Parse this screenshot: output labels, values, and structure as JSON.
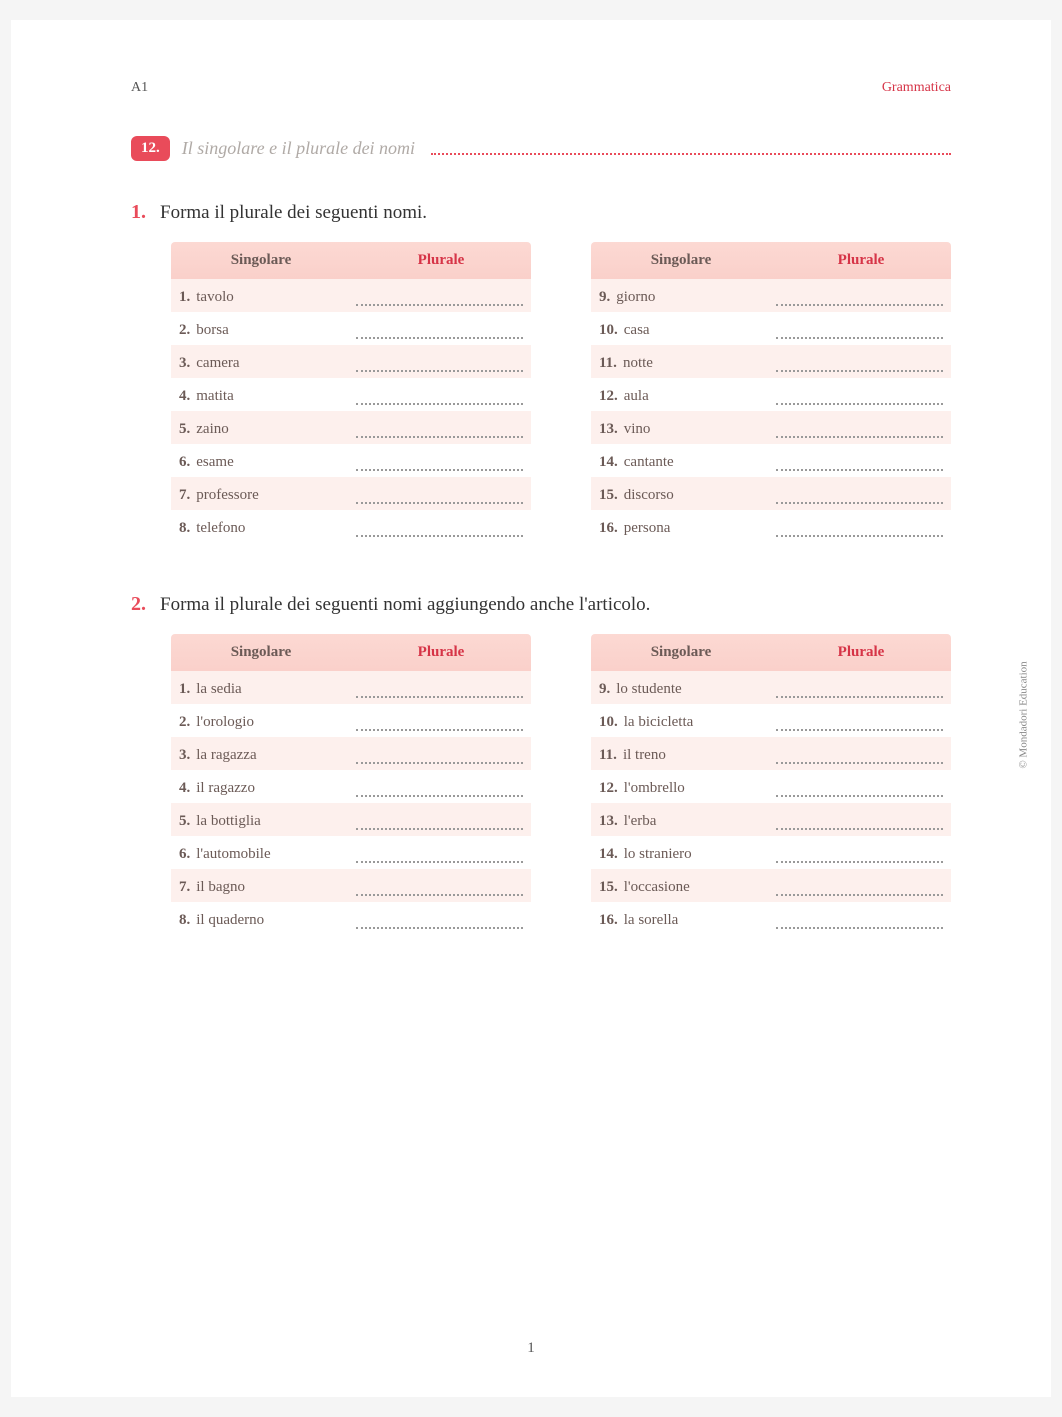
{
  "header": {
    "level": "A1",
    "section": "Grammatica"
  },
  "unit": {
    "number": "12.",
    "title": "Il singolare e il plurale dei nomi"
  },
  "exercise1": {
    "number": "1.",
    "prompt": "Forma il plurale dei seguenti nomi.",
    "col_singolare": "Singolare",
    "col_plurale": "Plurale",
    "left": [
      {
        "n": "1.",
        "word": "tavolo"
      },
      {
        "n": "2.",
        "word": "borsa"
      },
      {
        "n": "3.",
        "word": "camera"
      },
      {
        "n": "4.",
        "word": "matita"
      },
      {
        "n": "5.",
        "word": "zaino"
      },
      {
        "n": "6.",
        "word": "esame"
      },
      {
        "n": "7.",
        "word": "professore"
      },
      {
        "n": "8.",
        "word": "telefono"
      }
    ],
    "right": [
      {
        "n": "9.",
        "word": "giorno"
      },
      {
        "n": "10.",
        "word": "casa"
      },
      {
        "n": "11.",
        "word": "notte"
      },
      {
        "n": "12.",
        "word": "aula"
      },
      {
        "n": "13.",
        "word": "vino"
      },
      {
        "n": "14.",
        "word": "cantante"
      },
      {
        "n": "15.",
        "word": "discorso"
      },
      {
        "n": "16.",
        "word": "persona"
      }
    ]
  },
  "exercise2": {
    "number": "2.",
    "prompt": "Forma il plurale dei seguenti nomi aggiungendo anche l'articolo.",
    "col_singolare": "Singolare",
    "col_plurale": "Plurale",
    "left": [
      {
        "n": "1.",
        "word": "la sedia"
      },
      {
        "n": "2.",
        "word": "l'orologio"
      },
      {
        "n": "3.",
        "word": "la ragazza"
      },
      {
        "n": "4.",
        "word": "il ragazzo"
      },
      {
        "n": "5.",
        "word": "la bottiglia"
      },
      {
        "n": "6.",
        "word": "l'automobile"
      },
      {
        "n": "7.",
        "word": "il bagno"
      },
      {
        "n": "8.",
        "word": "il quaderno"
      }
    ],
    "right": [
      {
        "n": "9.",
        "word": "lo studente"
      },
      {
        "n": "10.",
        "word": "la bicicletta"
      },
      {
        "n": "11.",
        "word": "il treno"
      },
      {
        "n": "12.",
        "word": "l'ombrello"
      },
      {
        "n": "13.",
        "word": "l'erba"
      },
      {
        "n": "14.",
        "word": "lo straniero"
      },
      {
        "n": "15.",
        "word": "l'occasione"
      },
      {
        "n": "16.",
        "word": "la sorella"
      }
    ]
  },
  "copyright": "© Mondadori Education",
  "page_number": "1"
}
